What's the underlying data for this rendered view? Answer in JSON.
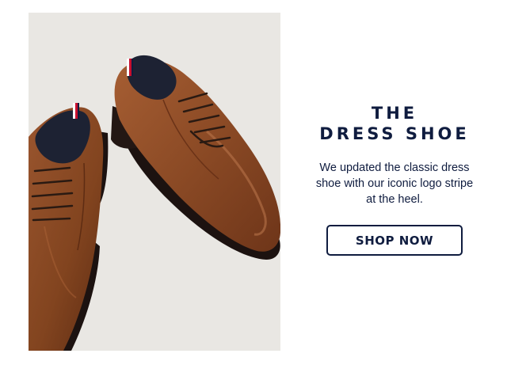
{
  "hero": {
    "image_subject": "pair of brown leather lace-up dress shoes",
    "headline_line1": "THE",
    "headline_line2": "DRESS SHOE",
    "body_line1": "We updated the classic dress",
    "body_line2": "shoe with our iconic logo stripe",
    "body_line3": "at the heel.",
    "cta_label": "SHOP NOW"
  },
  "colors": {
    "brand_navy": "#0f1c3f",
    "photo_background": "#e9e7e3",
    "leather_brown": "#8a4a26",
    "page_background": "#ffffff"
  }
}
